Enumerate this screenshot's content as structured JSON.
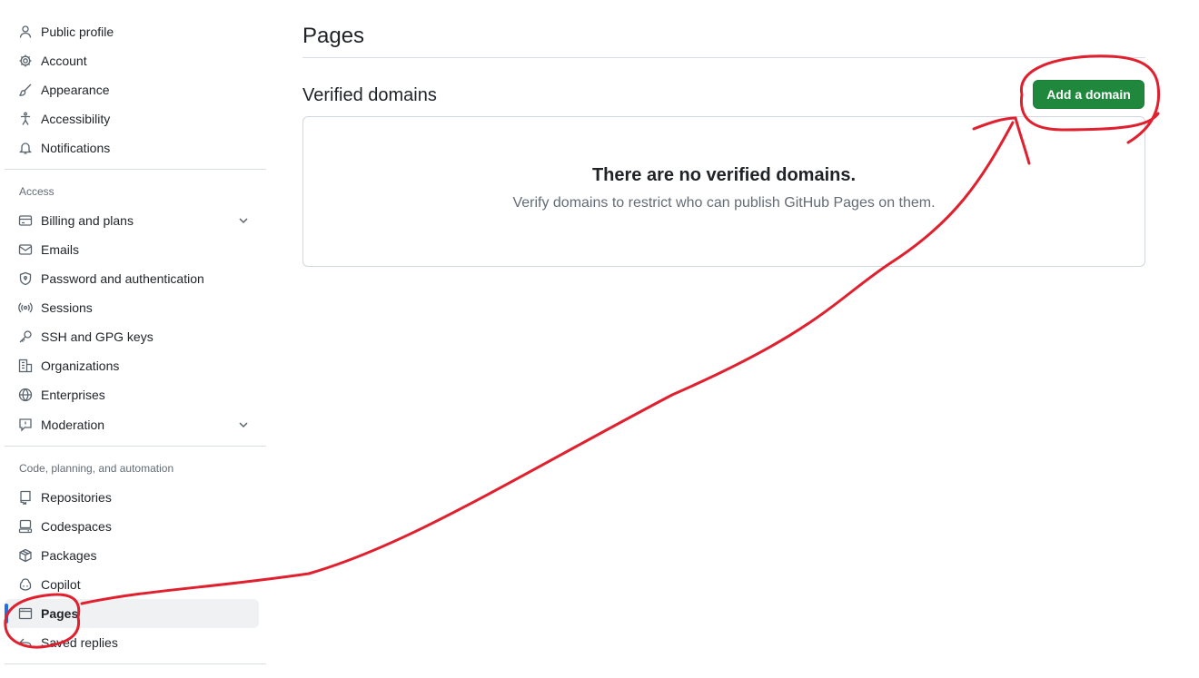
{
  "sidebar": {
    "top_items": [
      {
        "label": "Public profile",
        "icon": "person-icon"
      },
      {
        "label": "Account",
        "icon": "gear-icon"
      },
      {
        "label": "Appearance",
        "icon": "paintbrush-icon"
      },
      {
        "label": "Accessibility",
        "icon": "accessibility-icon"
      },
      {
        "label": "Notifications",
        "icon": "bell-icon"
      }
    ],
    "access_heading": "Access",
    "access_items": [
      {
        "label": "Billing and plans",
        "icon": "credit-card-icon",
        "expandable": true
      },
      {
        "label": "Emails",
        "icon": "mail-icon"
      },
      {
        "label": "Password and authentication",
        "icon": "shield-lock-icon"
      },
      {
        "label": "Sessions",
        "icon": "broadcast-icon"
      },
      {
        "label": "SSH and GPG keys",
        "icon": "key-icon"
      },
      {
        "label": "Organizations",
        "icon": "organization-icon"
      },
      {
        "label": "Enterprises",
        "icon": "globe-icon"
      },
      {
        "label": "Moderation",
        "icon": "report-icon",
        "expandable": true
      }
    ],
    "code_heading": "Code, planning, and automation",
    "code_items": [
      {
        "label": "Repositories",
        "icon": "repo-icon"
      },
      {
        "label": "Codespaces",
        "icon": "codespaces-icon"
      },
      {
        "label": "Packages",
        "icon": "package-icon"
      },
      {
        "label": "Copilot",
        "icon": "copilot-icon"
      },
      {
        "label": "Pages",
        "icon": "browser-icon",
        "active": true
      },
      {
        "label": "Saved replies",
        "icon": "reply-icon"
      }
    ]
  },
  "main": {
    "title": "Pages",
    "subhead": "Verified domains",
    "add_button_label": "Add a domain",
    "blankslate_title": "There are no verified domains.",
    "blankslate_desc": "Verify domains to restrict who can publish GitHub Pages on them."
  },
  "colors": {
    "accent_green": "#1f883d",
    "active_indicator": "#1f6feb",
    "annotation_red": "#e0202e"
  }
}
